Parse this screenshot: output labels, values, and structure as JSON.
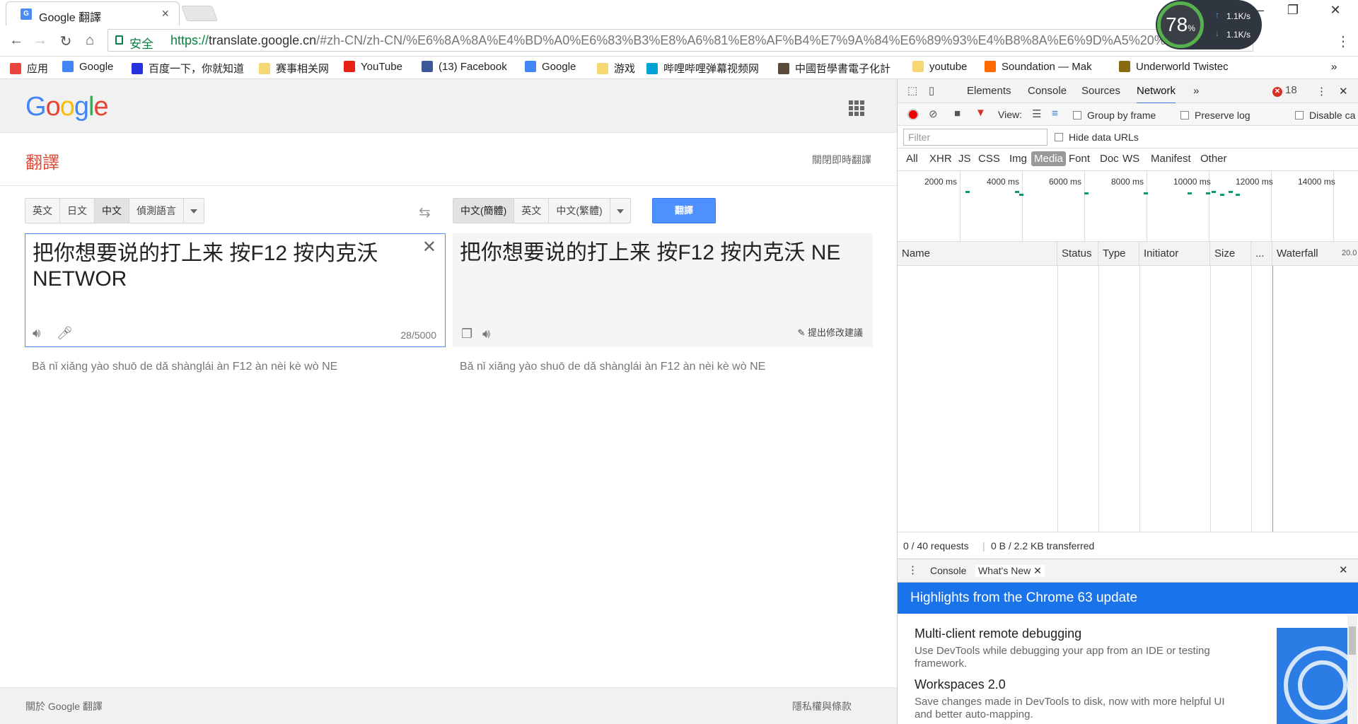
{
  "browser": {
    "tab_title": "Google 翻譯",
    "tab_favicon": "G",
    "secure_label": "安全",
    "url_proto": "https://",
    "url_host": "translate.google.cn",
    "url_path": "/#zh-CN/zh-CN/%E6%8A%8A%E4%BD%A0%E6%83%B3%E8%A6%81%E8%AF%B4%E7%9A%84%E6%89%93%E4%B8%8A%E6%9D%A5%20%E6%8C%89F12%20%20%...",
    "bookmarks": [
      {
        "label": "应用",
        "icon": "apps-icon",
        "color": "#e8453c"
      },
      {
        "label": "Google",
        "icon": "google-icon",
        "color": "#4285f4"
      },
      {
        "label": "百度一下，你就知道",
        "icon": "baidu-icon",
        "color": "#2932e1"
      },
      {
        "label": "赛事相关网",
        "icon": "folder-icon",
        "color": "#f7d774"
      },
      {
        "label": "YouTube",
        "icon": "youtube-icon",
        "color": "#e62117"
      },
      {
        "label": "(13) Facebook",
        "icon": "facebook-icon",
        "color": "#3b5998"
      },
      {
        "label": "Google",
        "icon": "google-icon",
        "color": "#4285f4"
      },
      {
        "label": "游戏",
        "icon": "folder-icon",
        "color": "#f7d774"
      },
      {
        "label": "哔哩哔哩弹幕视频网",
        "icon": "bilibili-icon",
        "color": "#00a1d6"
      },
      {
        "label": "中國哲學書電子化計",
        "icon": "globe-icon",
        "color": "#5a4a3a"
      },
      {
        "label": "youtube",
        "icon": "folder-icon",
        "color": "#f7d774"
      },
      {
        "label": "Soundation — Mak",
        "icon": "soundation-icon",
        "color": "#ff6a00"
      },
      {
        "label": "Underworld Twistec",
        "icon": "crown-icon",
        "color": "#8a6a10"
      }
    ],
    "gauge": {
      "percent": "78",
      "unit": "%",
      "up": "1.1K/s",
      "down": "1.1K/s"
    }
  },
  "translate": {
    "logo": "Google",
    "title": "翻譯",
    "instant_off": "關閉即時翻譯",
    "source_langs": [
      "英文",
      "日文",
      "中文",
      "偵測語言"
    ],
    "target_langs": [
      "中文(簡體)",
      "英文",
      "中文(繁體)"
    ],
    "translate_button": "翻譯",
    "source_text": "把你想要说的打上来 按F12  按内克沃 NETWOR",
    "char_count": "28/5000",
    "result_text": "把你想要说的打上来 按F12 按内克沃 NE",
    "suggest_edit": "提出修改建議",
    "src_translit": "Bǎ nǐ xiǎng yào shuō de dǎ shànglái àn F12 àn nèi kè wò NE",
    "dst_translit": "Bǎ nǐ xiǎng yào shuō de dǎ shànglái àn F12 àn nèi kè wò NE",
    "footer_about": "關於 Google 翻譯",
    "footer_privacy": "隱私權與條款"
  },
  "devtools": {
    "tabs": [
      "Elements",
      "Console",
      "Sources",
      "Network"
    ],
    "active_tab": "Network",
    "error_count": "18",
    "view_label": "View:",
    "group_by_frame": "Group by frame",
    "preserve_log": "Preserve log",
    "disable_cache": "Disable ca",
    "filter_placeholder": "Filter",
    "hide_data_urls": "Hide data URLs",
    "filter_types": [
      "All",
      "XHR",
      "JS",
      "CSS",
      "Img",
      "Media",
      "Font",
      "Doc",
      "WS",
      "Manifest",
      "Other"
    ],
    "active_type": "Media",
    "timeline_labels": [
      "2000 ms",
      "4000 ms",
      "6000 ms",
      "8000 ms",
      "10000 ms",
      "12000 ms",
      "14000 ms"
    ],
    "columns": [
      "Name",
      "Status",
      "Type",
      "Initiator",
      "Size",
      "...",
      "Waterfall"
    ],
    "waterfall_tick": "20.0",
    "requests_summary": "0 / 40 requests",
    "transfer_summary": "0 B / 2.2 KB transferred",
    "drawer_tabs": [
      "Console",
      "What's New"
    ],
    "banner": "Highlights from the Chrome 63 update",
    "news": [
      {
        "title": "Multi-client remote debugging",
        "desc": "Use DevTools while debugging your app from an IDE or testing framework."
      },
      {
        "title": "Workspaces 2.0",
        "desc": "Save changes made in DevTools to disk, now with more helpful UI and better auto-mapping."
      }
    ]
  }
}
